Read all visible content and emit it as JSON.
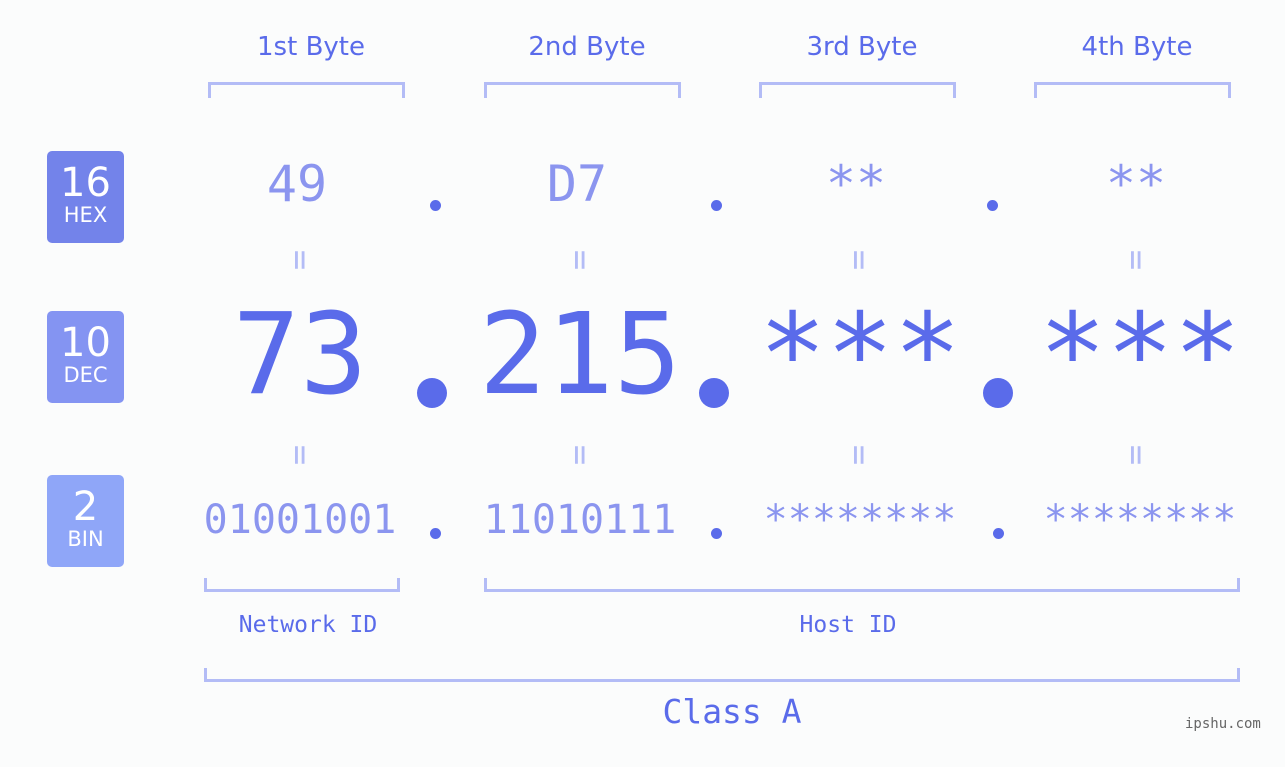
{
  "bases": {
    "hex": {
      "number": "16",
      "label": "HEX",
      "color": "#7383ea"
    },
    "dec": {
      "number": "10",
      "label": "DEC",
      "color": "#8494f2"
    },
    "bin": {
      "number": "2",
      "label": "BIN",
      "color": "#8fa6f8"
    }
  },
  "bytes": [
    {
      "label": "1st Byte",
      "hex": "49",
      "dec": "73",
      "bin": "01001001"
    },
    {
      "label": "2nd Byte",
      "hex": "D7",
      "dec": "215",
      "bin": "11010111"
    },
    {
      "label": "3rd Byte",
      "hex": "**",
      "dec": "***",
      "bin": "********"
    },
    {
      "label": "4th Byte",
      "hex": "**",
      "dec": "***",
      "bin": "********"
    }
  ],
  "equals_symbol": "=",
  "network_id_label": "Network ID",
  "host_id_label": "Host ID",
  "class_label": "Class A",
  "watermark": "ipshu.com",
  "colors": {
    "primary_text": "#5a6bea",
    "secondary_text": "#8b95ef",
    "bracket": "#b3bcf6",
    "background": "#fbfcfc"
  }
}
